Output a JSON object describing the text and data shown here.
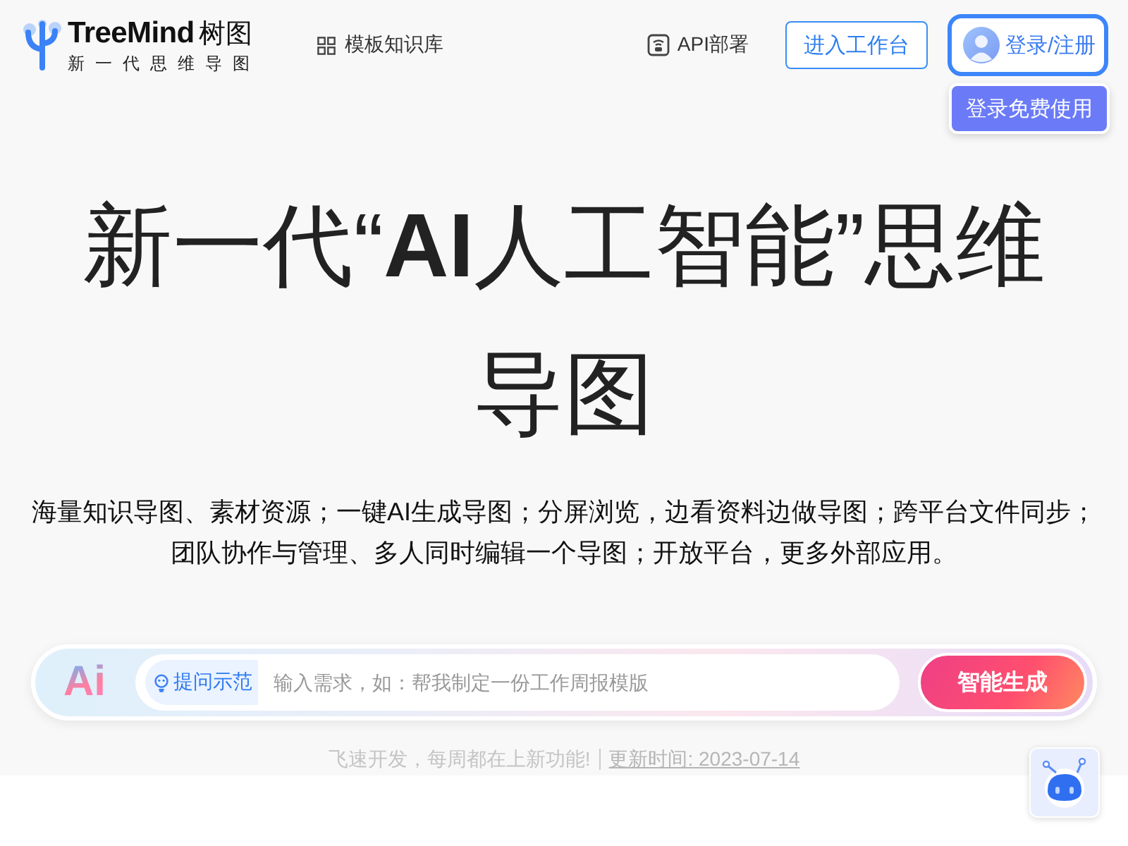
{
  "header": {
    "logo": {
      "brand": "TreeMind",
      "brand_cn": "树图",
      "tagline": "新一代思维导图"
    },
    "nav": [
      {
        "label": "模板知识库"
      }
    ],
    "api_link": {
      "label": "API部署"
    },
    "workspace_button": "进入工作台",
    "login_button": "登录/注册",
    "login_tooltip": "登录免费使用"
  },
  "hero": {
    "title": "新一代“**AI**人工智能”思维导图",
    "description": "海量知识导图、素材资源；一键AI生成导图；分屏浏览，边看资料边做导图；跨平台文件同步；团队协作与管理、多人同时编辑一个导图；开放平台，更多外部应用。"
  },
  "ai_input": {
    "badge": "Ai",
    "example_chip": "提问示范",
    "placeholder": "输入需求，如：帮我制定一份工作周报模版",
    "submit": "智能生成"
  },
  "update_note": {
    "text": "飞速开发，每周都在上新功能!",
    "link": "更新时间: 2023-07-14"
  }
}
